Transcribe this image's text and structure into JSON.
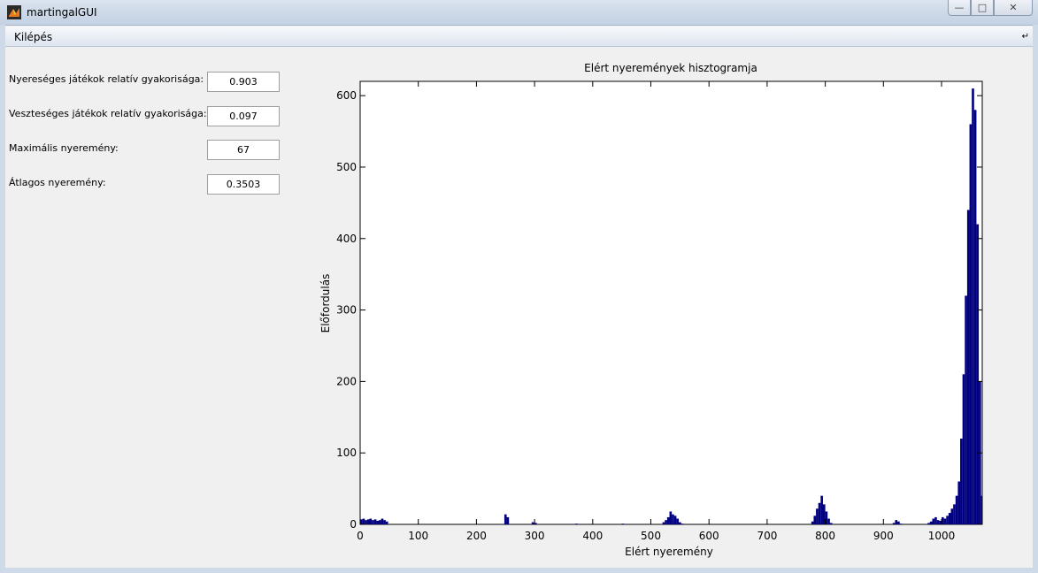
{
  "window": {
    "title": "martingalGUI",
    "buttons": {
      "minimize": "minimize-icon",
      "maximize": "maximize-icon",
      "close": "close-icon"
    }
  },
  "menu": {
    "items": [
      "Kilépés"
    ],
    "corner_icon": "dock-arrow-icon"
  },
  "stats": [
    {
      "label": "Nyereséges játékok relatív gyakorisága:",
      "value": "0.903"
    },
    {
      "label": "Veszteséges játékok relatív gyakorisága:",
      "value": "0.097"
    },
    {
      "label": "Maximális nyeremény:",
      "value": "67"
    },
    {
      "label": "Átlagos nyeremény:",
      "value": "0.3503"
    }
  ],
  "chart_data": {
    "type": "bar",
    "title": "Elért nyeremények hisztogramja",
    "xlabel": "Elért nyeremény",
    "ylabel": "Előfordulás",
    "xlim": [
      0,
      1070
    ],
    "ylim": [
      0,
      620
    ],
    "xticks": [
      0,
      100,
      200,
      300,
      400,
      500,
      600,
      700,
      800,
      900,
      1000
    ],
    "yticks": [
      0,
      100,
      200,
      300,
      400,
      500,
      600
    ],
    "bar_color": "#000080",
    "x": [
      0,
      4,
      8,
      12,
      16,
      20,
      24,
      28,
      32,
      36,
      40,
      44,
      248,
      252,
      295,
      300,
      370,
      450,
      520,
      524,
      528,
      532,
      536,
      540,
      544,
      548,
      552,
      776,
      780,
      784,
      788,
      792,
      796,
      800,
      804,
      808,
      916,
      920,
      924,
      928,
      976,
      980,
      984,
      988,
      992,
      996,
      1000,
      1004,
      1008,
      1012,
      1016,
      1020,
      1024,
      1028,
      1032,
      1036,
      1040,
      1044,
      1048,
      1052,
      1056,
      1060,
      1064,
      1068
    ],
    "values": [
      7,
      8,
      6,
      7,
      8,
      6,
      7,
      5,
      6,
      8,
      6,
      4,
      14,
      10,
      3,
      2,
      1,
      1,
      3,
      6,
      10,
      18,
      14,
      12,
      8,
      3,
      1,
      4,
      12,
      22,
      30,
      40,
      28,
      18,
      8,
      2,
      2,
      6,
      4,
      1,
      2,
      4,
      8,
      10,
      6,
      5,
      10,
      8,
      12,
      16,
      22,
      28,
      40,
      60,
      120,
      210,
      320,
      440,
      560,
      610,
      580,
      420,
      200,
      40
    ]
  }
}
